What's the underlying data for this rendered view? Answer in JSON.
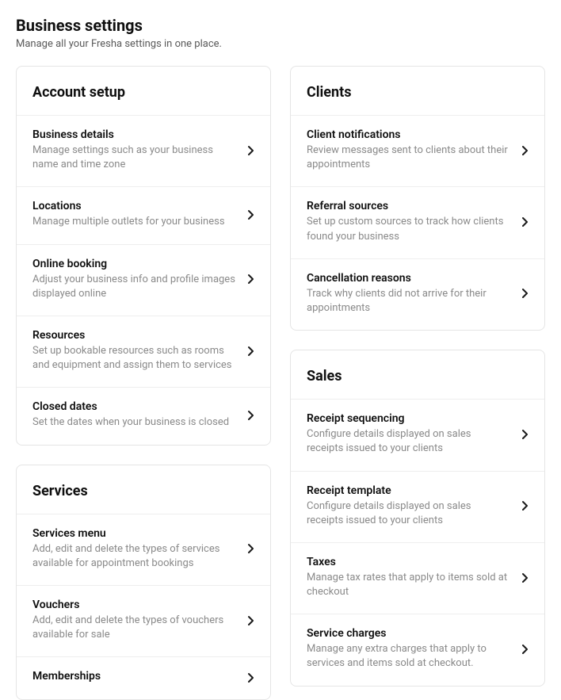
{
  "header": {
    "title": "Business settings",
    "subtitle": "Manage all your Fresha settings in one place."
  },
  "columns": [
    {
      "cards": [
        {
          "title": "Account setup",
          "name": "account-setup",
          "items": [
            {
              "title": "Business details",
              "desc": "Manage settings such as your business name and time zone",
              "name": "business-details"
            },
            {
              "title": "Locations",
              "desc": "Manage multiple outlets for your business",
              "name": "locations"
            },
            {
              "title": "Online booking",
              "desc": "Adjust your business info and profile images displayed online",
              "name": "online-booking"
            },
            {
              "title": "Resources",
              "desc": "Set up bookable resources such as rooms and equipment and assign them to services",
              "name": "resources"
            },
            {
              "title": "Closed dates",
              "desc": "Set the dates when your business is closed",
              "name": "closed-dates"
            }
          ]
        },
        {
          "title": "Services",
          "name": "services",
          "items": [
            {
              "title": "Services menu",
              "desc": "Add, edit and delete the types of services available for appointment bookings",
              "name": "services-menu"
            },
            {
              "title": "Vouchers",
              "desc": "Add, edit and delete the types of vouchers available for sale",
              "name": "vouchers"
            },
            {
              "title": "Memberships",
              "desc": "",
              "name": "memberships"
            }
          ]
        }
      ]
    },
    {
      "cards": [
        {
          "title": "Clients",
          "name": "clients",
          "items": [
            {
              "title": "Client notifications",
              "desc": "Review messages sent to clients about their appointments",
              "name": "client-notifications"
            },
            {
              "title": "Referral sources",
              "desc": "Set up custom sources to track how clients found your business",
              "name": "referral-sources"
            },
            {
              "title": "Cancellation reasons",
              "desc": "Track why clients did not arrive for their appointments",
              "name": "cancellation-reasons"
            }
          ]
        },
        {
          "title": "Sales",
          "name": "sales",
          "items": [
            {
              "title": "Receipt sequencing",
              "desc": "Configure details displayed on sales receipts issued to your clients",
              "name": "receipt-sequencing"
            },
            {
              "title": "Receipt template",
              "desc": "Configure details displayed on sales receipts issued to your clients",
              "name": "receipt-template"
            },
            {
              "title": "Taxes",
              "desc": "Manage tax rates that apply to items sold at checkout",
              "name": "taxes"
            },
            {
              "title": "Service charges",
              "desc": "Manage any extra charges that apply to services and items sold at checkout.",
              "name": "service-charges"
            }
          ]
        }
      ]
    }
  ]
}
